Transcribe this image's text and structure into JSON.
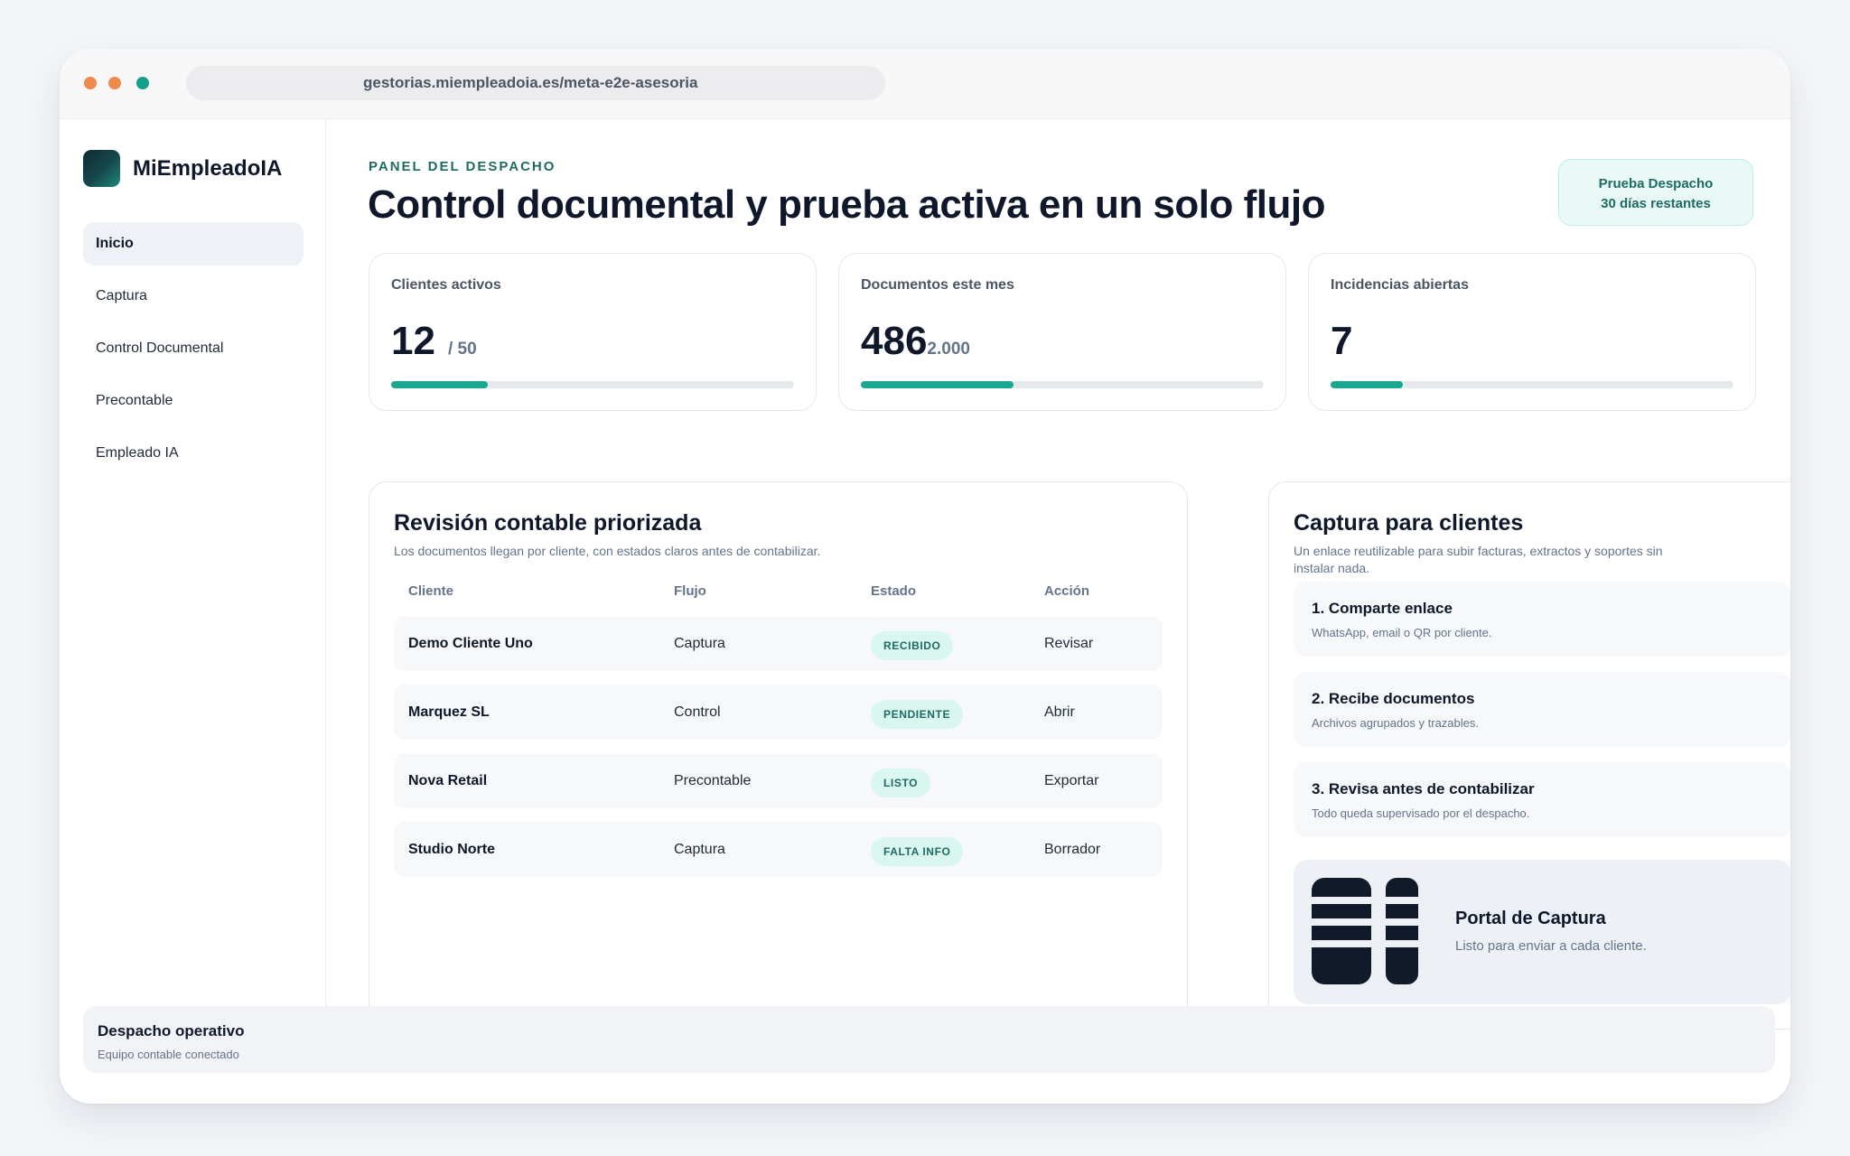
{
  "browser": {
    "url": "gestorias.miempleadoia.es/meta-e2e-asesoria"
  },
  "brand": {
    "name": "MiEmpleadoIA"
  },
  "sidebar": {
    "items": [
      {
        "label": "Inicio",
        "active": true
      },
      {
        "label": "Captura",
        "active": false
      },
      {
        "label": "Control Documental",
        "active": false
      },
      {
        "label": "Precontable",
        "active": false
      },
      {
        "label": "Empleado IA",
        "active": false
      }
    ]
  },
  "header": {
    "eyebrow": "PANEL DEL DESPACHO",
    "title": "Control documental y prueba activa en un solo flujo",
    "trial_line1": "Prueba Despacho",
    "trial_line2": "30 días restantes"
  },
  "stats": [
    {
      "label": "Clientes activos",
      "value": "12",
      "of": "/ 50",
      "progress": 0.24
    },
    {
      "label": "Documentos este mes",
      "value": "486",
      "of": "2.000",
      "progress": 0.38
    },
    {
      "label": "Incidencias abiertas",
      "value": "7",
      "of": "",
      "progress": 0.18
    }
  ],
  "review": {
    "title": "Revisión contable priorizada",
    "subtitle": "Los documentos llegan por cliente, con estados claros antes de contabilizar.",
    "columns": [
      "Cliente",
      "Flujo",
      "Estado",
      "Acción"
    ],
    "rows": [
      {
        "client": "Demo Cliente Uno",
        "flow": "Captura",
        "status": "RECIBIDO",
        "action": "Revisar"
      },
      {
        "client": "Marquez SL",
        "flow": "Control",
        "status": "PENDIENTE",
        "action": "Abrir"
      },
      {
        "client": "Nova Retail",
        "flow": "Precontable",
        "status": "LISTO",
        "action": "Exportar"
      },
      {
        "client": "Studio Norte",
        "flow": "Captura",
        "status": "FALTA INFO",
        "action": "Borrador"
      }
    ]
  },
  "capture": {
    "title": "Captura para clientes",
    "subtitle_line1": "Un enlace reutilizable para subir facturas, extractos y soportes sin",
    "subtitle_line2": "instalar nada.",
    "steps": [
      {
        "title": "1. Comparte enlace",
        "desc": "WhatsApp, email o QR por cliente."
      },
      {
        "title": "2. Recibe documentos",
        "desc": "Archivos agrupados y trazables."
      },
      {
        "title": "3. Revisa antes de contabilizar",
        "desc": "Todo queda supervisado por el despacho."
      }
    ],
    "portal": {
      "title": "Portal de Captura",
      "subtitle": "Listo para enviar a cada cliente.",
      "icon": "qr-code-icon"
    }
  },
  "footer": {
    "title": "Despacho operativo",
    "subtitle": "Equipo contable conectado"
  },
  "colors": {
    "accent": "#17a88f",
    "accent_dark": "#1f6b63",
    "pill_bg": "#d9f7ef",
    "dot_orange": "#f08a4b",
    "dot_green": "#14a08c"
  }
}
